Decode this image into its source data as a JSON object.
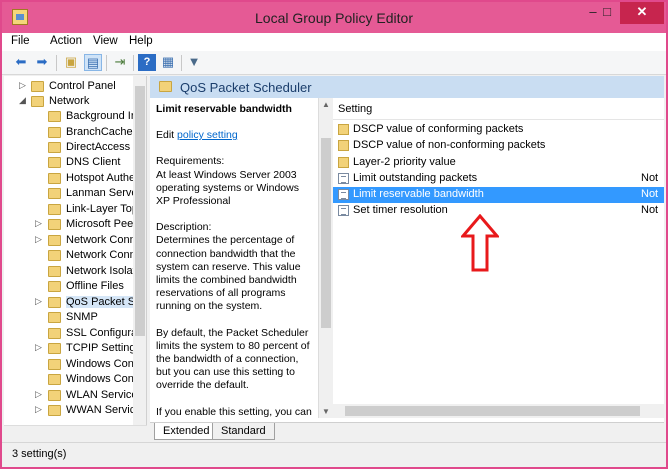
{
  "window": {
    "title": "Local Group Policy Editor",
    "min": "–",
    "max": "□",
    "close": "✕"
  },
  "menu": [
    "File",
    "Action",
    "View",
    "Help"
  ],
  "toolbar": {
    "icons": [
      "back-arrow-icon",
      "forward-arrow-icon",
      "up-folder-icon",
      "show-hide-tree-icon",
      "export-list-icon",
      "help-icon",
      "properties-icon",
      "filter-icon"
    ]
  },
  "tree": {
    "items": [
      {
        "label": "Control Panel",
        "expander": "▷"
      },
      {
        "label": "Network",
        "expander": "◢"
      },
      {
        "label": "Background Ir",
        "expander": ""
      },
      {
        "label": "BranchCache",
        "expander": ""
      },
      {
        "label": "DirectAccess C",
        "expander": ""
      },
      {
        "label": "DNS Client",
        "expander": ""
      },
      {
        "label": "Hotspot Authe",
        "expander": ""
      },
      {
        "label": "Lanman Serve",
        "expander": ""
      },
      {
        "label": "Link-Layer Top",
        "expander": ""
      },
      {
        "label": "Microsoft Peer",
        "expander": "▷"
      },
      {
        "label": "Network Conn",
        "expander": "▷"
      },
      {
        "label": "Network Conn",
        "expander": ""
      },
      {
        "label": "Network Isolat",
        "expander": ""
      },
      {
        "label": "Offline Files",
        "expander": ""
      },
      {
        "label": "QoS Packet Sc",
        "expander": "▷"
      },
      {
        "label": "SNMP",
        "expander": ""
      },
      {
        "label": "SSL Configura",
        "expander": ""
      },
      {
        "label": "TCPIP Settings",
        "expander": "▷"
      },
      {
        "label": "Windows Con",
        "expander": ""
      },
      {
        "label": "Windows Con",
        "expander": ""
      },
      {
        "label": "WLAN Service",
        "expander": "▷"
      },
      {
        "label": "WWAN Service",
        "expander": "▷"
      }
    ]
  },
  "header": {
    "title": "QoS Packet Scheduler"
  },
  "description": {
    "title": "Limit reservable bandwidth",
    "edit_prefix": "Edit ",
    "edit_link": "policy setting",
    "req_label": "Requirements:",
    "req_text": "At least Windows Server 2003 operating systems or Windows XP Professional",
    "desc_label": "Description:",
    "desc_text": "Determines the percentage of connection bandwidth that the system can reserve. This value limits the combined bandwidth reservations of all programs running on the system.",
    "default_text": "By default, the Packet Scheduler limits the system to 80 percent of the bandwidth of a connection, but you can use this setting to override the default.",
    "enable_text": "If you enable this setting, you can use the \"Bandwidth limit\" box to"
  },
  "list": {
    "column": "Setting",
    "rows": [
      {
        "name": "DSCP value of conforming packets",
        "type": "folder",
        "state": ""
      },
      {
        "name": "DSCP value of non-conforming packets",
        "type": "folder",
        "state": ""
      },
      {
        "name": "Layer-2 priority value",
        "type": "folder",
        "state": ""
      },
      {
        "name": "Limit outstanding packets",
        "type": "policy",
        "state": "Not"
      },
      {
        "name": "Limit reservable bandwidth",
        "type": "policy",
        "state": "Not"
      },
      {
        "name": "Set timer resolution",
        "type": "policy",
        "state": "Not"
      }
    ]
  },
  "tabs": [
    "Extended",
    "Standard"
  ],
  "status": "3 setting(s)",
  "colors": {
    "titlebar": "#e55a95",
    "selection": "#3399ff",
    "arrow": "#e8191b",
    "link": "#0066cc"
  }
}
